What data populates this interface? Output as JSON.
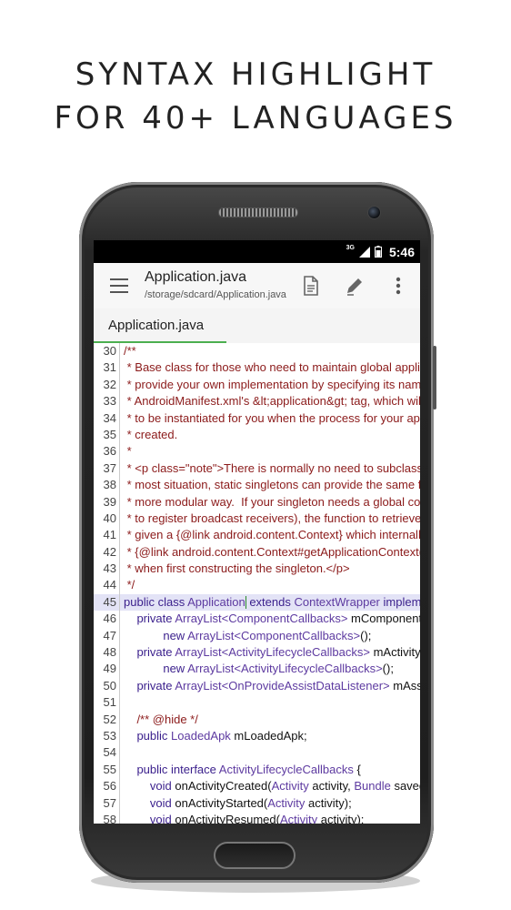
{
  "headline": {
    "line1": "SYNTAX HIGHLIGHT",
    "line2": "FOR 40+ LANGUAGES"
  },
  "statusbar": {
    "network": "3G",
    "time": "5:46"
  },
  "toolbar": {
    "title": "Application.java",
    "path": "/storage/sdcard/Application.java",
    "icons": [
      "menu-icon",
      "document-icon",
      "pencil-icon",
      "more-vertical-icon"
    ]
  },
  "tabs": [
    {
      "label": "Application.java",
      "active": true
    }
  ],
  "colors": {
    "comment": "#8b1a1a",
    "keyword": "#3a1f8c",
    "type": "#5d3aa0",
    "tab_underline": "#4caf50",
    "current_line": "#e3e3f6"
  },
  "code": [
    {
      "n": "30",
      "tokens": [
        {
          "t": "/**",
          "c": "comment"
        }
      ]
    },
    {
      "n": "31",
      "tokens": [
        {
          "t": " * Base class for those who need to maintain global application state.",
          "c": "comment"
        }
      ]
    },
    {
      "n": "32",
      "tokens": [
        {
          "t": " * provide your own implementation by specifying its name in your",
          "c": "comment"
        }
      ]
    },
    {
      "n": "33",
      "tokens": [
        {
          "t": " * AndroidManifest.xml's &lt;application&gt; tag, which will cause",
          "c": "comment"
        }
      ]
    },
    {
      "n": "34",
      "tokens": [
        {
          "t": " * to be instantiated for you when the process for your application",
          "c": "comment"
        }
      ]
    },
    {
      "n": "35",
      "tokens": [
        {
          "t": " * created.",
          "c": "comment"
        }
      ]
    },
    {
      "n": "36",
      "tokens": [
        {
          "t": " *",
          "c": "comment"
        }
      ]
    },
    {
      "n": "37",
      "tokens": [
        {
          "t": " * <p class=\"note\">There is normally no need to subclass Application.",
          "c": "comment"
        }
      ]
    },
    {
      "n": "38",
      "tokens": [
        {
          "t": " * most situation, static singletons can provide the same functionality",
          "c": "comment"
        }
      ]
    },
    {
      "n": "39",
      "tokens": [
        {
          "t": " * more modular way.  If your singleton needs a global context",
          "c": "comment"
        }
      ]
    },
    {
      "n": "40",
      "tokens": [
        {
          "t": " * to register broadcast receivers), the function to retrieve it",
          "c": "comment"
        }
      ]
    },
    {
      "n": "41",
      "tokens": [
        {
          "t": " * given a {@link android.content.Context} which internally uses",
          "c": "comment"
        }
      ]
    },
    {
      "n": "42",
      "tokens": [
        {
          "t": " * {@link android.content.Context#getApplicationContext()",
          "c": "comment"
        }
      ]
    },
    {
      "n": "43",
      "tokens": [
        {
          "t": " * when first constructing the singleton.</p>",
          "c": "comment"
        }
      ]
    },
    {
      "n": "44",
      "tokens": [
        {
          "t": " */",
          "c": "comment"
        }
      ]
    },
    {
      "n": "45",
      "current": true,
      "tokens": [
        {
          "t": "public class ",
          "c": "kw"
        },
        {
          "t": "Application",
          "c": "type"
        },
        {
          "t": "",
          "c": "cursor"
        },
        {
          "t": " extends ",
          "c": "kw"
        },
        {
          "t": "ContextWrapper ",
          "c": "type"
        },
        {
          "t": "implements",
          "c": "kw"
        }
      ]
    },
    {
      "n": "46",
      "tokens": [
        {
          "t": "    private ",
          "c": "kw"
        },
        {
          "t": "ArrayList<ComponentCallbacks>",
          "c": "type"
        },
        {
          "t": " mComponentCallbacks =",
          "c": "plain"
        }
      ]
    },
    {
      "n": "47",
      "tokens": [
        {
          "t": "            new ",
          "c": "kw"
        },
        {
          "t": "ArrayList<ComponentCallbacks>",
          "c": "type"
        },
        {
          "t": "();",
          "c": "plain"
        }
      ]
    },
    {
      "n": "48",
      "tokens": [
        {
          "t": "    private ",
          "c": "kw"
        },
        {
          "t": "ArrayList<ActivityLifecycleCallbacks>",
          "c": "type"
        },
        {
          "t": " mActivityLifecycleCallbacks =",
          "c": "plain"
        }
      ]
    },
    {
      "n": "49",
      "tokens": [
        {
          "t": "            new ",
          "c": "kw"
        },
        {
          "t": "ArrayList<ActivityLifecycleCallbacks>",
          "c": "type"
        },
        {
          "t": "();",
          "c": "plain"
        }
      ]
    },
    {
      "n": "50",
      "tokens": [
        {
          "t": "    private ",
          "c": "kw"
        },
        {
          "t": "ArrayList<OnProvideAssistDataListener>",
          "c": "type"
        },
        {
          "t": " mAssistCallbacks",
          "c": "plain"
        }
      ]
    },
    {
      "n": "51",
      "tokens": [
        {
          "t": "",
          "c": "plain"
        }
      ]
    },
    {
      "n": "52",
      "tokens": [
        {
          "t": "    /** @hide */",
          "c": "comment"
        }
      ]
    },
    {
      "n": "53",
      "tokens": [
        {
          "t": "    public ",
          "c": "kw"
        },
        {
          "t": "LoadedApk",
          "c": "type"
        },
        {
          "t": " mLoadedApk;",
          "c": "plain"
        }
      ]
    },
    {
      "n": "54",
      "tokens": [
        {
          "t": "",
          "c": "plain"
        }
      ]
    },
    {
      "n": "55",
      "tokens": [
        {
          "t": "    public interface ",
          "c": "kw"
        },
        {
          "t": "ActivityLifecycleCallbacks",
          "c": "type"
        },
        {
          "t": " {",
          "c": "plain"
        }
      ]
    },
    {
      "n": "56",
      "tokens": [
        {
          "t": "        void ",
          "c": "kw"
        },
        {
          "t": "onActivityCreated(",
          "c": "plain"
        },
        {
          "t": "Activity",
          "c": "type"
        },
        {
          "t": " activity, ",
          "c": "plain"
        },
        {
          "t": "Bundle",
          "c": "type"
        },
        {
          "t": " savedInstanceState);",
          "c": "plain"
        }
      ]
    },
    {
      "n": "57",
      "tokens": [
        {
          "t": "        void ",
          "c": "kw"
        },
        {
          "t": "onActivityStarted(",
          "c": "plain"
        },
        {
          "t": "Activity",
          "c": "type"
        },
        {
          "t": " activity);",
          "c": "plain"
        }
      ]
    },
    {
      "n": "58",
      "tokens": [
        {
          "t": "        void ",
          "c": "kw"
        },
        {
          "t": "onActivityResumed(",
          "c": "plain"
        },
        {
          "t": "Activity",
          "c": "type"
        },
        {
          "t": " activity);",
          "c": "plain"
        }
      ]
    }
  ]
}
